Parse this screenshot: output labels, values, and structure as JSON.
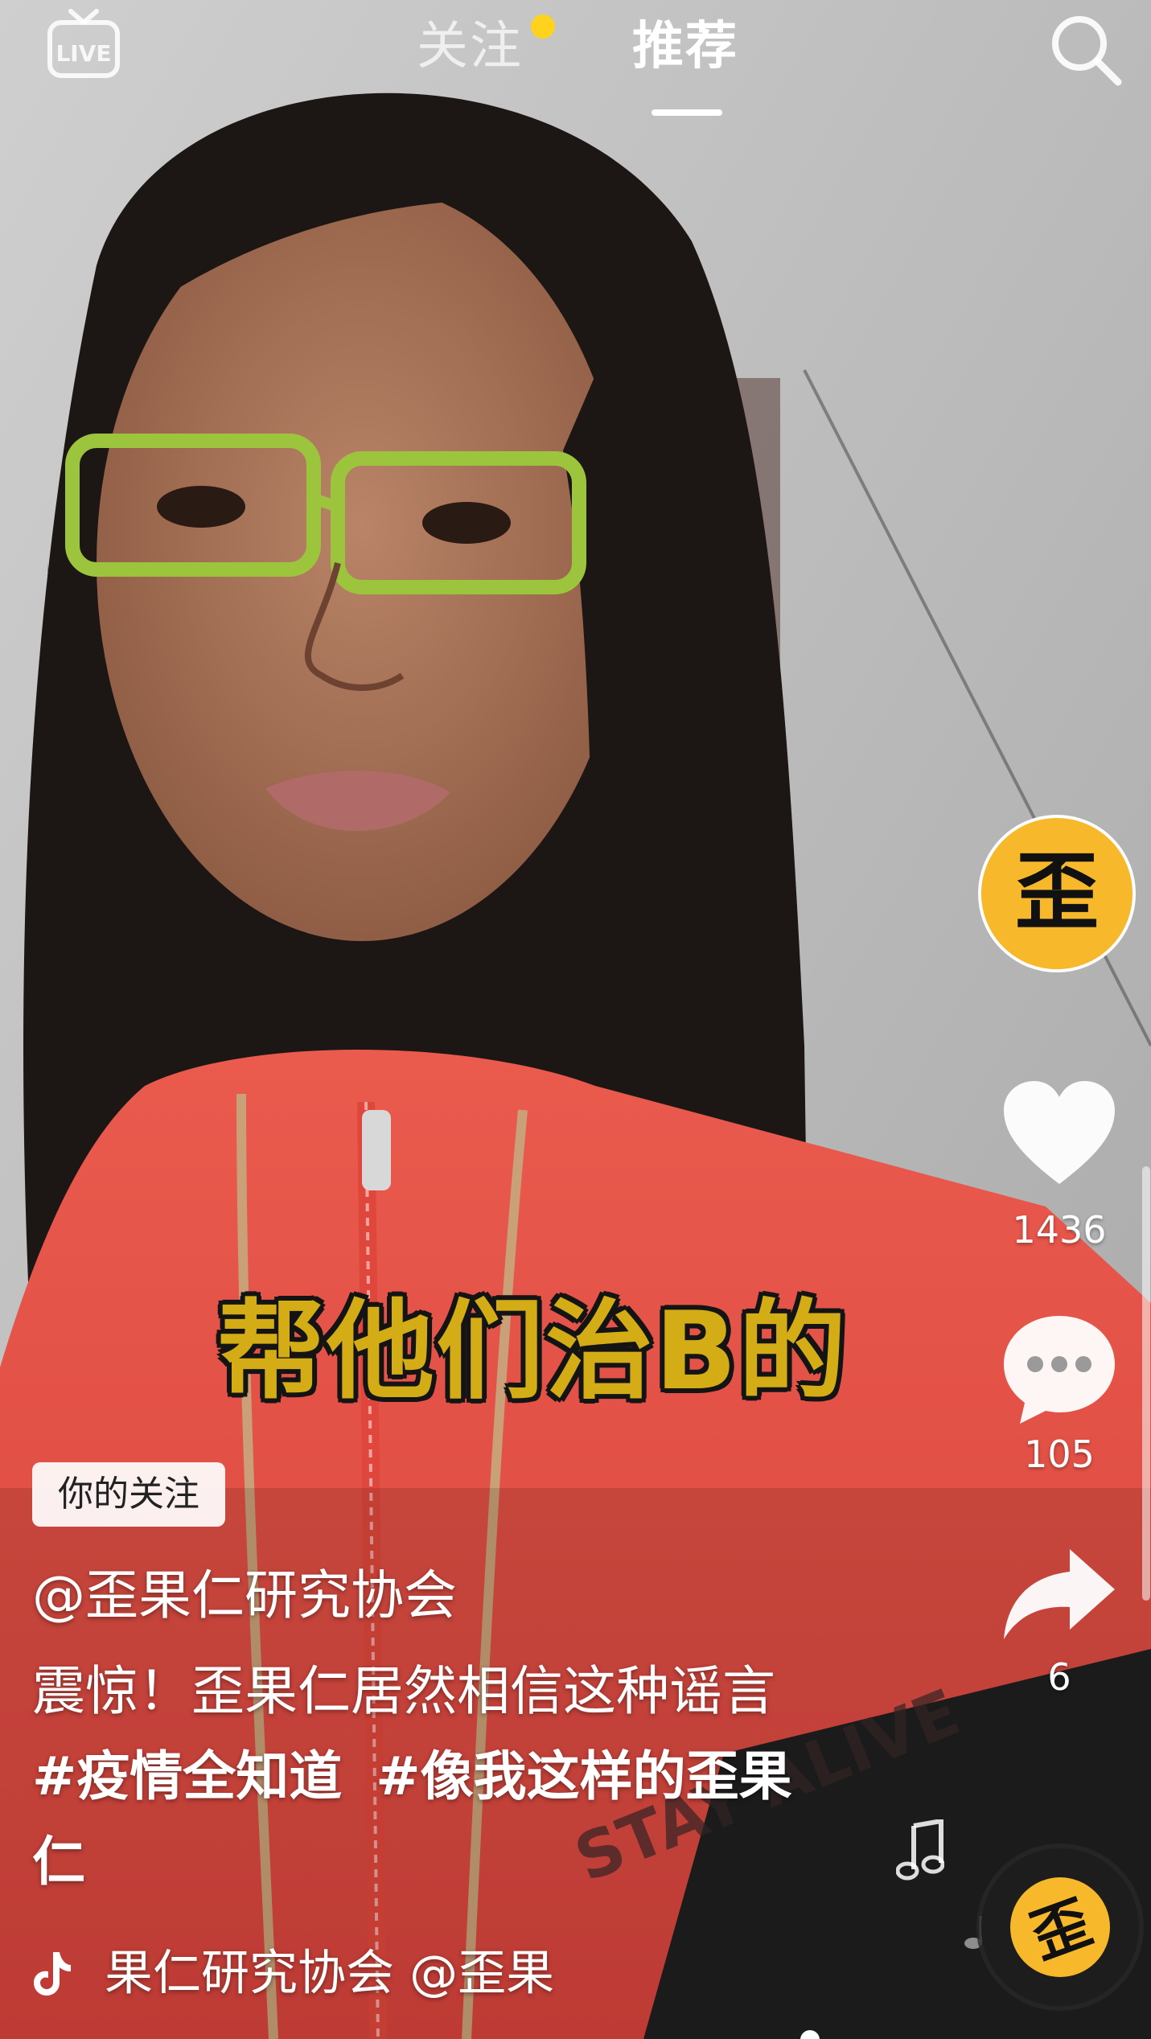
{
  "top_bar": {
    "live_icon": "live-tv-icon",
    "tab_follow": "关注",
    "tab_recommend": "推荐",
    "active_tab": "推荐",
    "has_new_dot": true,
    "search_icon": "search-icon"
  },
  "video": {
    "subtitle": "帮他们治B的",
    "shirt_text": "STAY ALIVE"
  },
  "rail": {
    "avatar_glyph": "歪",
    "like_count": "1436",
    "comment_count": "105",
    "share_count": "6"
  },
  "info": {
    "follow_badge": "你的关注",
    "author": "@歪果仁研究协会",
    "description_text": "震惊！歪果仁居然相信这种谣言 ",
    "hashtag_1": "#疫情全知道",
    "hashtag_2": "#像我这样的歪果仁",
    "music_text": "果仁研究协会    @歪果"
  },
  "music_disc": {
    "glyph": "歪"
  },
  "colors": {
    "accent_yellow": "#ffd21d",
    "subtitle_yellow": "#d4ac16",
    "avatar_yellow": "#f7b82b"
  }
}
